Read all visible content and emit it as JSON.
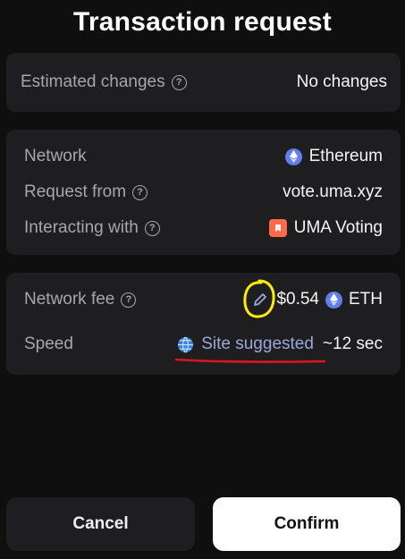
{
  "header": {
    "title": "Transaction request"
  },
  "changes": {
    "label": "Estimated changes",
    "value": "No changes"
  },
  "details": {
    "network_label": "Network",
    "network_value": "Ethereum",
    "request_label": "Request from",
    "request_value": "vote.uma.xyz",
    "interacting_label": "Interacting with",
    "interacting_value": "UMA Voting"
  },
  "fee": {
    "label": "Network fee",
    "amount": "$0.54",
    "currency": "ETH",
    "speed_label": "Speed",
    "speed_source": "Site suggested",
    "speed_time": "~12 sec"
  },
  "actions": {
    "cancel_label": "Cancel",
    "confirm_label": "Confirm"
  },
  "colors": {
    "background": "#0f0f10",
    "card": "#1e1e20",
    "eth": "#627eea",
    "uma": "#ff6b4a",
    "annotation_yellow": "#ffee00",
    "annotation_red": "#e0141e"
  },
  "icons": [
    "help-icon",
    "ethereum-icon",
    "uma-icon",
    "pencil-icon",
    "globe-icon"
  ]
}
